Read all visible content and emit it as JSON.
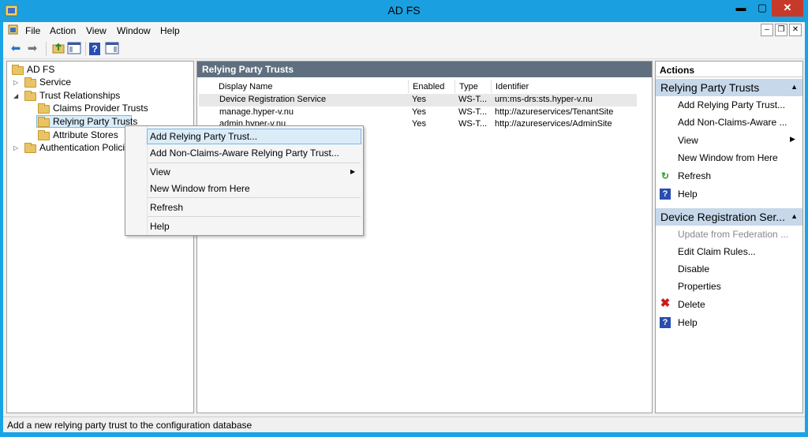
{
  "window": {
    "title": "AD FS",
    "min": "▬",
    "max": "▢",
    "close": "✕"
  },
  "menu": [
    "File",
    "Action",
    "View",
    "Window",
    "Help"
  ],
  "mdi": {
    "min": "–",
    "restore": "❐",
    "close": "✕"
  },
  "tree": {
    "root": "AD FS",
    "service": "Service",
    "trust_relationships": "Trust Relationships",
    "claims_provider_trusts": "Claims Provider Trusts",
    "relying_party_trusts": "Relying Party Trusts",
    "attribute_stores": "Attribute Stores",
    "authentication_policies": "Authentication Policie"
  },
  "center": {
    "header": "Relying Party Trusts",
    "columns": [
      "Display Name",
      "Enabled",
      "Type",
      "Identifier"
    ],
    "rows": [
      [
        "Device Registration Service",
        "Yes",
        "WS-T...",
        "urn:ms-drs:sts.hyper-v.nu"
      ],
      [
        "manage.hyper-v.nu",
        "Yes",
        "WS-T...",
        "http://azureservices/TenantSite"
      ],
      [
        "admin.hyper-v.nu",
        "Yes",
        "WS-T...",
        "http://azureservices/AdminSite"
      ]
    ]
  },
  "context_menu": {
    "add_rp": "Add Relying Party Trust...",
    "add_nca": "Add Non-Claims-Aware Relying Party Trust...",
    "view": "View",
    "new_window": "New Window from Here",
    "refresh": "Refresh",
    "help": "Help"
  },
  "actions": {
    "header": "Actions",
    "section1": {
      "title": "Relying Party Trusts",
      "items": [
        "Add Relying Party Trust...",
        "Add Non-Claims-Aware ...",
        "View",
        "New Window from Here",
        "Refresh",
        "Help"
      ]
    },
    "section2": {
      "title": "Device Registration Ser...",
      "items": [
        "Update from Federation ...",
        "Edit Claim Rules...",
        "Disable",
        "Properties",
        "Delete",
        "Help"
      ]
    }
  },
  "status": "Add a new relying party trust to the configuration database",
  "icons": {
    "help": "?",
    "refresh": "↻",
    "delete": "✖",
    "back": "⬅",
    "forward": "➡"
  }
}
